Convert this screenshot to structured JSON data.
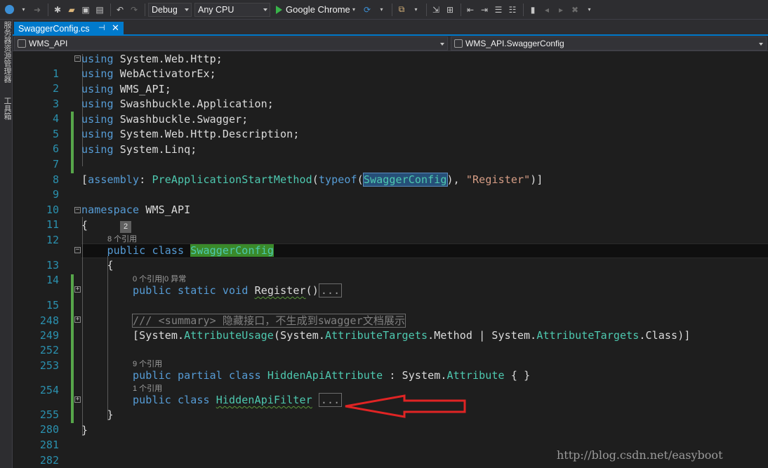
{
  "toolbar": {
    "config": "Debug",
    "platform": "Any CPU",
    "run_target": "Google Chrome"
  },
  "left_strip": {
    "server_explorer": "服务器资源管理器",
    "toolbox": "工具箱"
  },
  "tab": {
    "label": "SwaggerConfig.cs",
    "pin": "⊣",
    "close": "✕"
  },
  "navbar": {
    "project": "WMS_API",
    "member": "WMS_API.SwaggerConfig"
  },
  "editor": {
    "line_numbers": [
      "1",
      "2",
      "3",
      "4",
      "5",
      "6",
      "7",
      "8",
      "9",
      "10",
      "11",
      "12",
      "13",
      "14",
      "15",
      "248",
      "249",
      "252",
      "253",
      "254",
      "255",
      "280",
      "281",
      "282"
    ],
    "peek_badge": "2",
    "lens": {
      "class_refs": "8 个引用",
      "register_refs": "0 个引用|0 异常",
      "hidden_attr_refs": "9 个引用",
      "hidden_filter_refs": "1 个引用"
    },
    "code": {
      "l1": {
        "kw": "using",
        "rest": " System.Web.Http;"
      },
      "l2": {
        "kw": "using",
        "rest": " WebActivatorEx;"
      },
      "l3": {
        "kw": "using",
        "rest": " WMS_API;"
      },
      "l4": {
        "kw": "using",
        "rest": " Swashbuckle.Application;"
      },
      "l5": {
        "kw": "using",
        "rest": " Swashbuckle.Swagger;"
      },
      "l6": {
        "kw": "using",
        "rest": " System.Web.Http.Description;"
      },
      "l7": {
        "kw": "using",
        "rest": " System.Linq;"
      },
      "l9": {
        "open": "[",
        "assembly": "assembly",
        "colon": ": ",
        "attr": "PreApplicationStartMethod",
        "paren": "(",
        "typeof": "typeof",
        "paren2": "(",
        "cls": "SwaggerConfig",
        "close": "), ",
        "str": "\"Register\"",
        "end": ")]"
      },
      "l11": {
        "kw": "namespace",
        "rest": " WMS_API"
      },
      "l12": "{",
      "l13": {
        "kw1": "public",
        "kw2": "class",
        "cls": "SwaggerConfig"
      },
      "l14": "{",
      "l15": {
        "kw1": "public",
        "kw2": "static",
        "kw3": "void",
        "name": "Register",
        "parens": "()",
        "ellipsis": "..."
      },
      "l249": {
        "slashes": "/// ",
        "tag": "<summary>",
        "text": " 隐藏接口，不生成到swagger文档展示"
      },
      "l252": {
        "open": "[System.",
        "attr": "AttributeUsage",
        "mid1": "(System.",
        "t1": "AttributeTargets",
        "mid2": ".Method | System.",
        "t2": "AttributeTargets",
        "end": ".Class)]"
      },
      "l254": {
        "kw1": "public",
        "kw2": "partial",
        "kw3": "class",
        "name": "HiddenApiAttribute",
        "mid": " : System.",
        "base": "Attribute",
        "end": " { }"
      },
      "l255": {
        "kw1": "public",
        "kw2": "class",
        "name": "HiddenApiFilter",
        "ellipsis": "..."
      },
      "l280": "}",
      "l281": "}"
    }
  },
  "watermark": "http://blog.csdn.net/easyboot",
  "colors": {
    "accent": "#007acc",
    "keyword": "#569cd6",
    "type": "#4ec9b0",
    "string": "#d69d85",
    "line_number": "#2b91af",
    "arrow": "#e02424"
  }
}
